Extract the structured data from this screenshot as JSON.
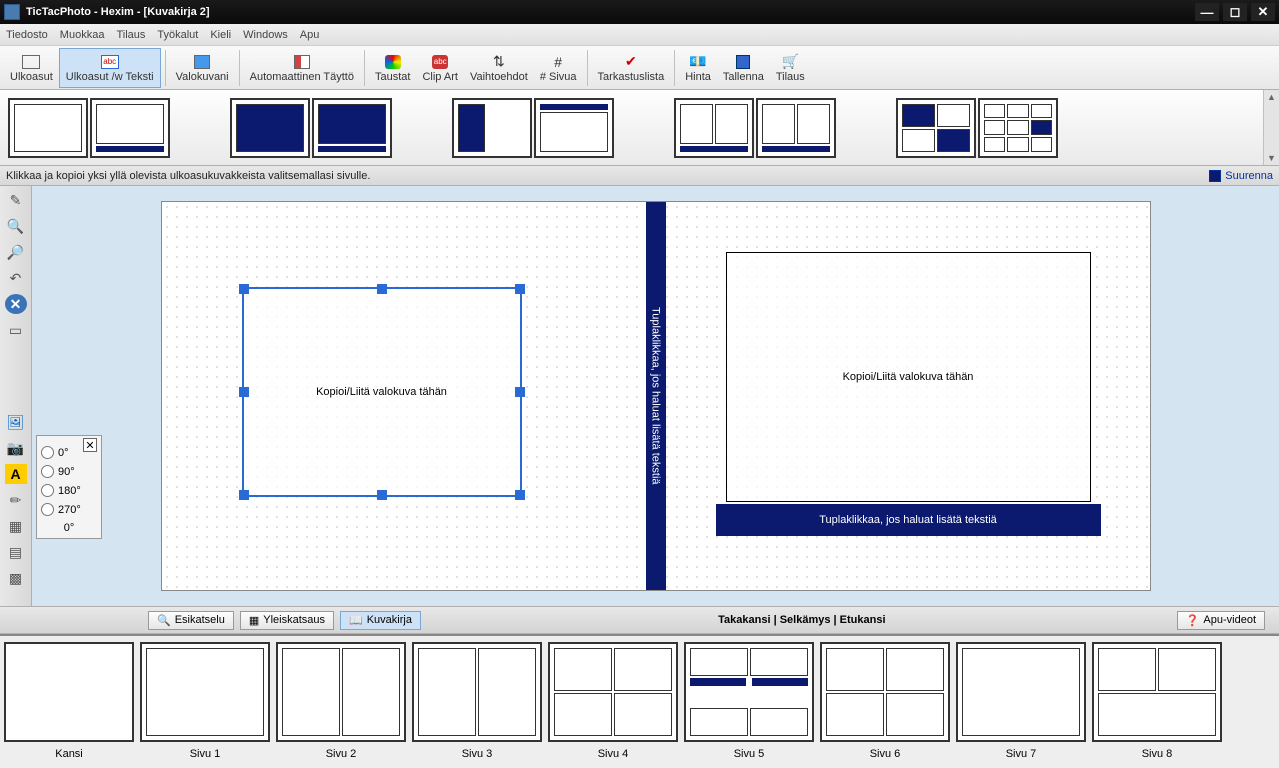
{
  "title": "TicTacPhoto - Hexim - [Kuvakirja 2]",
  "menu": [
    "Tiedosto",
    "Muokkaa",
    "Tilaus",
    "Työkalut",
    "Kieli",
    "Windows",
    "Apu"
  ],
  "toolbar": [
    {
      "label": "Ulkoasut",
      "icon": "layout"
    },
    {
      "label": "Ulkoasut /w Teksti",
      "icon": "layout-text",
      "active": true
    },
    {
      "label": "Valokuvani",
      "icon": "photos"
    },
    {
      "label": "Automaattinen Täyttö",
      "icon": "autofill"
    },
    {
      "label": "Taustat",
      "icon": "bg"
    },
    {
      "label": "Clip Art",
      "icon": "clipart"
    },
    {
      "label": "Vaihtoehdot",
      "icon": "options"
    },
    {
      "label": "# Sivua",
      "icon": "pages"
    },
    {
      "label": "Tarkastuslista",
      "icon": "checklist"
    },
    {
      "label": "Hinta",
      "icon": "price"
    },
    {
      "label": "Tallenna",
      "icon": "save"
    },
    {
      "label": "Tilaus",
      "icon": "order"
    }
  ],
  "hint": "Klikkaa ja kopioi yksi yllä olevista ulkoasukuvakkeista valitsemallasi sivulle.",
  "expand": "Suurenna",
  "rotation": {
    "options": [
      "0°",
      "90°",
      "180°",
      "270°"
    ],
    "value": "0°"
  },
  "spine_text": "Tuplaklikkaa, jos haluat lisätä tekstiä",
  "photo_placeholder": "Kopioi/Liitä valokuva tähän",
  "textbar_text": "Tuplaklikkaa, jos haluat lisätä tekstiä",
  "bottom_buttons": [
    {
      "label": "Esikatselu",
      "active": false
    },
    {
      "label": "Yleiskatsaus",
      "active": false
    },
    {
      "label": "Kuvakirja",
      "active": true
    }
  ],
  "bottom_center": "Takakansi | Selkämys | Etukansi",
  "help_videos": "Apu-videot",
  "pages": [
    "Kansi",
    "Sivu 1",
    "Sivu 2",
    "Sivu 3",
    "Sivu 4",
    "Sivu 5",
    "Sivu 6",
    "Sivu 7",
    "Sivu 8"
  ]
}
